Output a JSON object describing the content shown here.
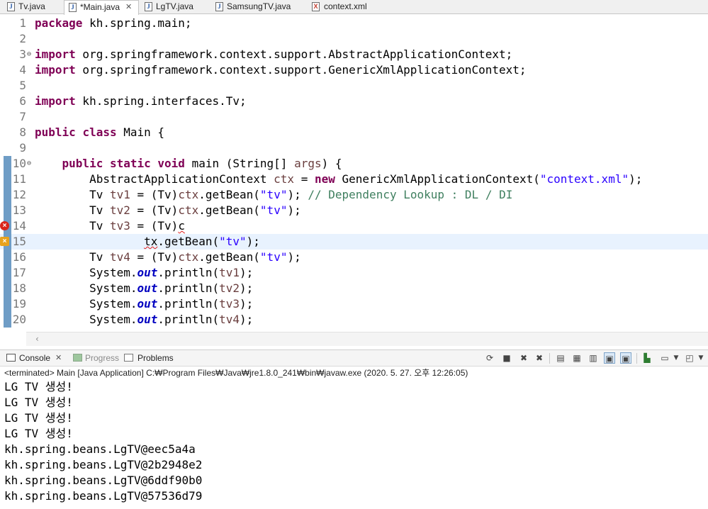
{
  "editor_tabs": [
    {
      "label": "Tv.java",
      "icon": "java-file-icon"
    },
    {
      "label": "*Main.java",
      "icon": "java-file-icon",
      "active": true
    },
    {
      "label": "LgTV.java",
      "icon": "java-file-icon"
    },
    {
      "label": "SamsungTV.java",
      "icon": "java-file-icon"
    },
    {
      "label": "context.xml",
      "icon": "xml-file-icon"
    }
  ],
  "tab_close_glyph": "✕",
  "code": {
    "line_numbers": [
      "1",
      "2",
      "3",
      "4",
      "5",
      "6",
      "7",
      "8",
      "9",
      "10",
      "11",
      "12",
      "13",
      "14",
      "15",
      "16",
      "17",
      "18",
      "19",
      "20"
    ],
    "l1": {
      "kw": "package",
      "rest": " kh.spring.main;"
    },
    "l3": {
      "kw": "import",
      "rest": " org.springframework.context.support.AbstractApplicationContext;"
    },
    "l4": {
      "kw": "import",
      "rest": " org.springframework.context.support.GenericXmlApplicationContext;"
    },
    "l6": {
      "kw": "import",
      "rest": " kh.spring.interfaces.Tv;"
    },
    "l8": {
      "kw1": "public",
      "kw2": "class",
      "rest": " Main {"
    },
    "l10": {
      "indent": "    ",
      "kw1": "public",
      "kw2": "static",
      "kw3": "void",
      "a": " main (String[] ",
      "var": "args",
      "b": ") {"
    },
    "l11": {
      "a": "        AbstractApplicationContext ",
      "var": "ctx",
      "b": " = ",
      "kw": "new",
      "c": " GenericXmlApplicationContext(",
      "str": "\"context.xml\"",
      "d": ");"
    },
    "l12": {
      "a": "        Tv ",
      "var": "tv1",
      "b": " = (Tv)",
      "var2": "ctx",
      "c": ".getBean(",
      "str": "\"tv\"",
      "d": "); ",
      "cmt": "// Dependency Lookup : DL / DI"
    },
    "l13": {
      "a": "        Tv ",
      "var": "tv2",
      "b": " = (Tv)",
      "var2": "ctx",
      "c": ".getBean(",
      "str": "\"tv\"",
      "d": ");"
    },
    "l14": {
      "a": "        Tv ",
      "var": "tv3",
      "b": " = (Tv)",
      "err": "c"
    },
    "l15": {
      "a": "                ",
      "err": "tx",
      "b": ".getBean(",
      "str": "\"tv\"",
      "c": ");"
    },
    "l16": {
      "a": "        Tv ",
      "var": "tv4",
      "b": " = (Tv)",
      "var2": "ctx",
      "c": ".getBean(",
      "str": "\"tv\"",
      "d": ");"
    },
    "l17": {
      "a": "        System.",
      "fld": "out",
      "b": ".println(",
      "var": "tv1",
      "c": ");"
    },
    "l18": {
      "a": "        System.",
      "fld": "out",
      "b": ".println(",
      "var": "tv2",
      "c": ");"
    },
    "l19": {
      "a": "        System.",
      "fld": "out",
      "b": ".println(",
      "var": "tv3",
      "c": ");"
    },
    "l20": {
      "a": "        System.",
      "fld": "out",
      "b": ".println(",
      "var": "tv4",
      "c": ");"
    }
  },
  "views": {
    "console": "Console",
    "progress": "Progress",
    "problems": "Problems"
  },
  "terminated_line": "<terminated> Main [Java Application] C:₩Program Files₩Java₩jre1.8.0_241₩bin₩javaw.exe (2020. 5. 27. 오후 12:26:05)",
  "console_output": [
    "LG TV 생성!",
    "LG TV 생성!",
    "LG TV 생성!",
    "LG TV 생성!",
    "kh.spring.beans.LgTV@eec5a4a",
    "kh.spring.beans.LgTV@2b2948e2",
    "kh.spring.beans.LgTV@6ddf90b0",
    "kh.spring.beans.LgTV@57536d79"
  ],
  "colors": {
    "keyword": "#7f0055",
    "string": "#2a00ff",
    "comment": "#3f7f5f",
    "local_var": "#6a3e3e",
    "field": "#0000c0",
    "current_line": "#e8f2fe",
    "error": "#d9261c"
  }
}
